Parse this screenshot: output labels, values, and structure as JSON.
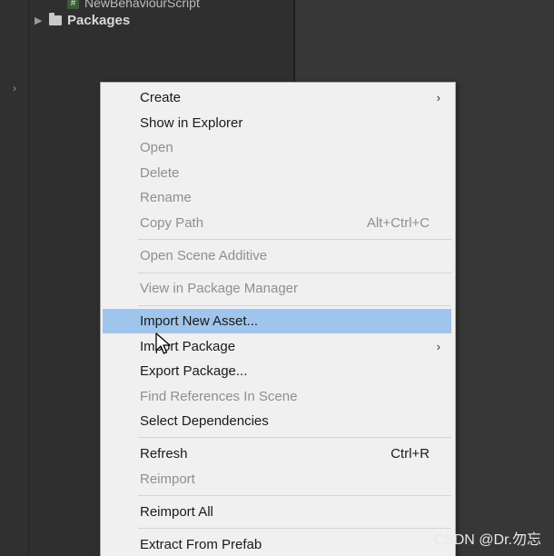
{
  "project": {
    "script_name": "NewBehaviourScript",
    "packages_label": "Packages",
    "script_icon_glyph": "#"
  },
  "menu": {
    "create": "Create",
    "show_in_explorer": "Show in Explorer",
    "open": "Open",
    "delete": "Delete",
    "rename": "Rename",
    "copy_path": "Copy Path",
    "copy_path_shortcut": "Alt+Ctrl+C",
    "open_scene_additive": "Open Scene Additive",
    "view_in_package_manager": "View in Package Manager",
    "import_new_asset": "Import New Asset...",
    "import_package": "Import Package",
    "export_package": "Export Package...",
    "find_references": "Find References In Scene",
    "select_dependencies": "Select Dependencies",
    "refresh": "Refresh",
    "refresh_shortcut": "Ctrl+R",
    "reimport": "Reimport",
    "reimport_all": "Reimport All",
    "extract_from_prefab": "Extract From Prefab"
  },
  "icons": {
    "submenu_arrow": "›",
    "expand_triangle": "▶",
    "collapse_arrow": "›"
  },
  "colors": {
    "menu_bg": "#f0f0f0",
    "highlight": "#9fc5ec",
    "disabled_text": "#8f8f8f"
  },
  "watermark": "CSDN @Dr.勿忘"
}
